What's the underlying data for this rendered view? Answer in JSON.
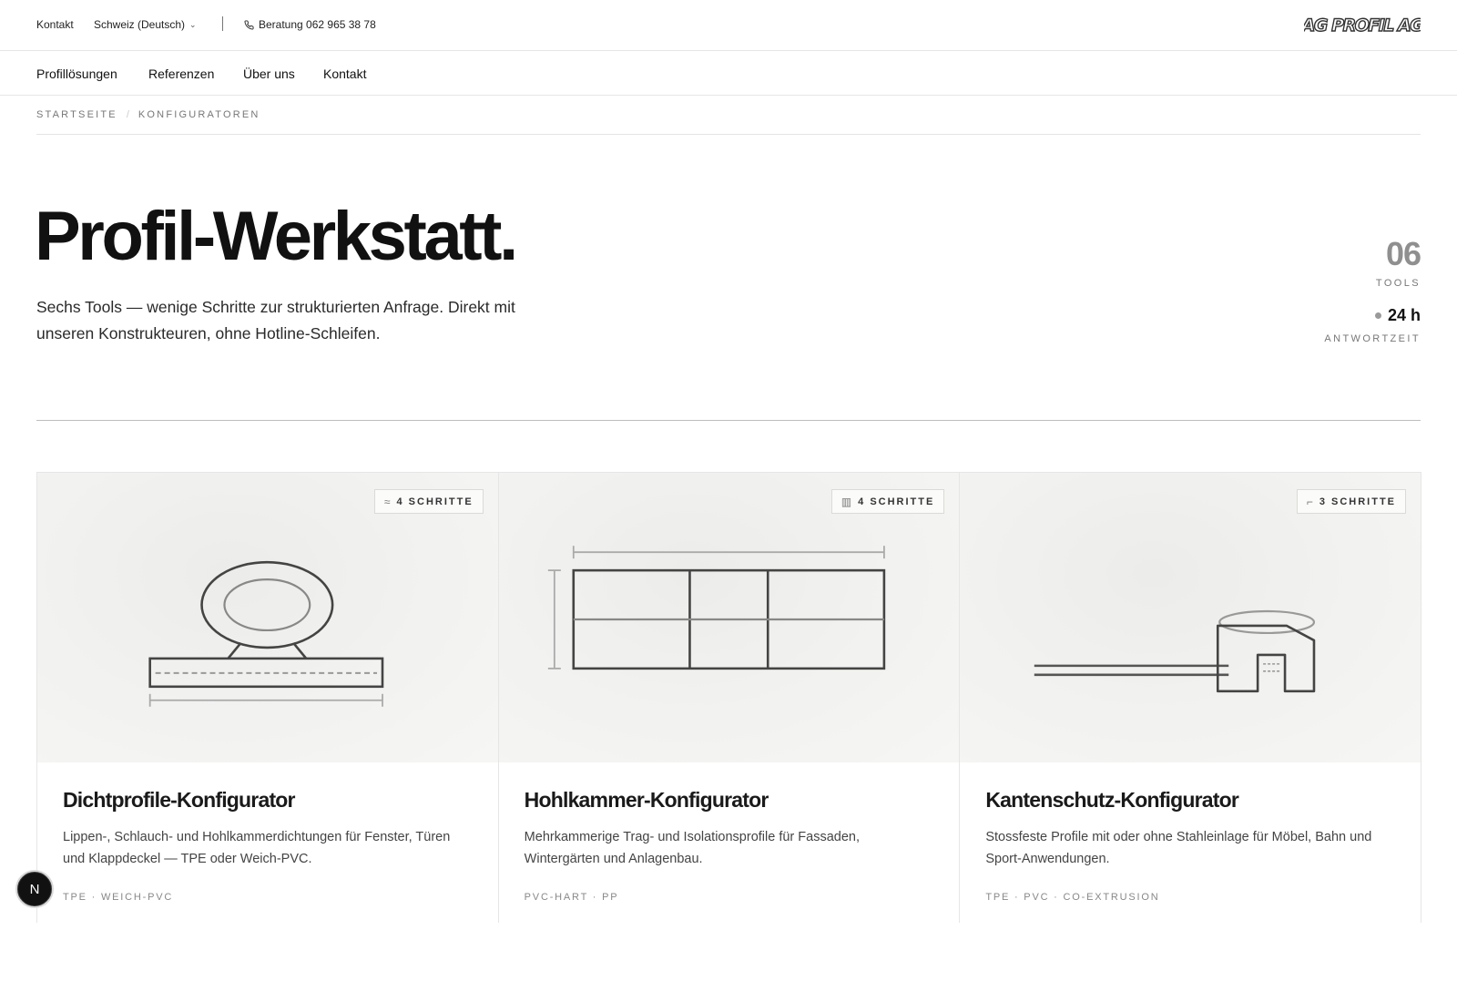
{
  "topbar": {
    "kontakt": "Kontakt",
    "region": "Schweiz (Deutsch)",
    "phone": "Beratung 062 965 38 78",
    "logo_text": "AG PROFIL AG"
  },
  "nav": {
    "items": [
      {
        "label": "Profillösungen"
      },
      {
        "label": "Referenzen"
      },
      {
        "label": "Über uns"
      },
      {
        "label": "Kontakt"
      }
    ]
  },
  "breadcrumb": {
    "home": "STARTSEITE",
    "separator": "/",
    "current": "KONFIGURATOREN"
  },
  "hero": {
    "title": "Profil-Werkstatt.",
    "subtitle": "Sechs Tools — wenige Schritte zur strukturierten Anfrage. Direkt mit unseren Konstrukteuren, ohne Hotline-Schleifen."
  },
  "stats": {
    "tools_count": "06",
    "tools_label": "TOOLS",
    "response_time": "24 h",
    "response_label": "ANTWORTZEIT"
  },
  "cards": [
    {
      "badge_icon": "≈",
      "badge": "4 SCHRITTE",
      "title": "Dichtprofile-Konfigurator",
      "description": "Lippen-, Schlauch- und Hohlkammerdichtungen für Fenster, Türen und Klappdeckel — TPE oder Weich-PVC.",
      "tags": "TPE · WEICH-PVC"
    },
    {
      "badge_icon": "▥",
      "badge": "4 SCHRITTE",
      "title": "Hohlkammer-Konfigurator",
      "description": "Mehrkammerige Trag- und Isolationsprofile für Fassaden, Wintergärten und Anlagenbau.",
      "tags": "PVC-HART · PP"
    },
    {
      "badge_icon": "⌐",
      "badge": "3 SCHRITTE",
      "title": "Kantenschutz-Konfigurator",
      "description": "Stossfeste Profile mit oder ohne Stahleinlage für Möbel, Bahn und Sport-Anwendungen.",
      "tags": "TPE · PVC · CO-EXTRUSION"
    }
  ],
  "floating_badge": "N",
  "colors": {
    "text": "#111111",
    "muted": "#777777",
    "border": "#e6e6e6",
    "illustration_bg": "#f2f2f0",
    "stroke": "#444444"
  }
}
